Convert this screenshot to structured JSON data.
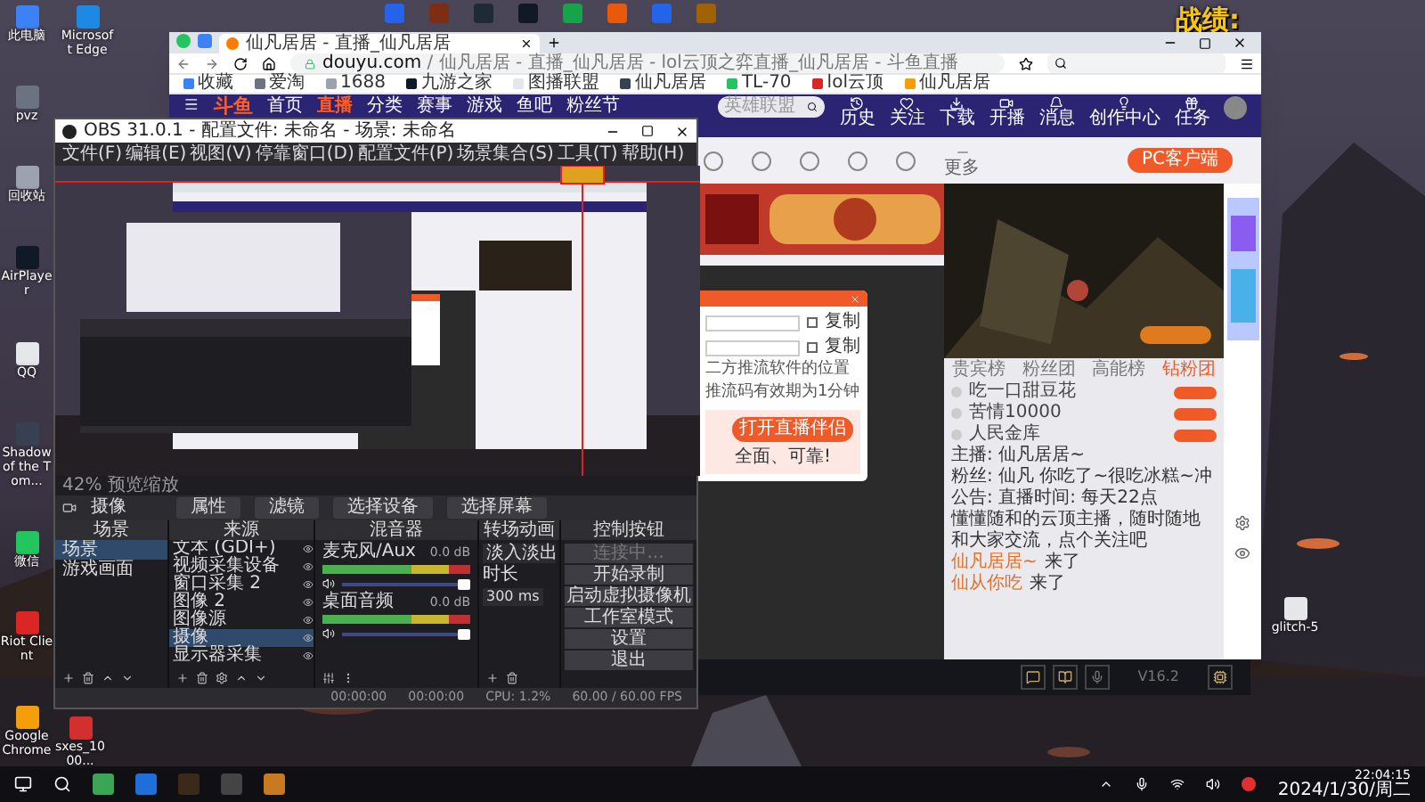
{
  "overlay_text": "战绩:",
  "desktop_icons": [
    {
      "label": "此电脑"
    },
    {
      "label": "pvz"
    },
    {
      "label": "回收站"
    },
    {
      "label": "AirPlayer"
    },
    {
      "label": "QQ"
    },
    {
      "label": "Shadow of the Tom..."
    },
    {
      "label": "微信"
    },
    {
      "label": "Riot Client"
    },
    {
      "label": "Google Chrome"
    }
  ],
  "desktop_icons_2": [
    {
      "label": "Microsoft Edge"
    }
  ],
  "desktop_icon_bottom": {
    "label": "sxes_1000..."
  },
  "desktop_icon_right": {
    "label": "glitch-5"
  },
  "browser": {
    "tab_title": "仙凡居居 - 直播_仙凡居居",
    "url_host": "douyu.com",
    "url_path": " / 仙凡居居 - 直播_仙凡居居 - lol云顶之弈直播_仙凡居居 - 斗鱼直播",
    "bookmarks": [
      "收藏",
      "爱淘",
      "1688",
      "九游之家",
      "图播联盟",
      "仙凡居居",
      "TL-70",
      "lol云顶",
      "仙凡居居"
    ],
    "logo": "斗鱼",
    "nav": [
      {
        "label": "首页",
        "selected": false
      },
      {
        "label": "直播",
        "selected": true
      },
      {
        "label": "分类",
        "selected": false
      },
      {
        "label": "赛事",
        "selected": false
      },
      {
        "label": "游戏",
        "selected": false
      },
      {
        "label": "鱼吧",
        "selected": false
      },
      {
        "label": "粉丝节",
        "selected": false
      }
    ],
    "search_placeholder": "英雄联盟",
    "header_icons": [
      "历史",
      "关注",
      "下载",
      "开播",
      "消息",
      "创作中心",
      "任务"
    ],
    "more_tool": "更多",
    "pc_client_button": "PC客户端",
    "dialog": {
      "copy_labels": [
        {
          "label": "复制",
          "checked": false
        },
        {
          "label": "复制",
          "checked": false
        }
      ],
      "lines": [
        "二方推流软件的位置",
        "推流码有效期为1分钟"
      ],
      "button": "打开直播伴侣",
      "note": "全面、可靠!"
    },
    "chat": {
      "tabs": [
        {
          "label": "贵宾榜",
          "selected": false
        },
        {
          "label": "粉丝团",
          "selected": false
        },
        {
          "label": "高能榜",
          "selected": false
        },
        {
          "label": "钻粉团",
          "selected": true
        }
      ],
      "ranks": [
        "吃一口甜豆花",
        "苦情10000",
        "人民金库"
      ],
      "notices": [
        {
          "label": "主播:",
          "text": "仙凡居居~"
        },
        {
          "label": "粉丝:",
          "text": "仙凡 你吃了~很吃冰糕~冲"
        },
        {
          "label": "公告:",
          "text": "直播时间: 每天22点"
        }
      ],
      "description": "懂懂随和的云顶主播，随时随地和大家交流，点个关注吧",
      "entries": [
        {
          "name": "仙凡居居~",
          "text": "来了"
        },
        {
          "name": "仙从你吃",
          "text": "来了"
        }
      ]
    }
  },
  "lol_bar": {
    "version": "V16.2"
  },
  "obs": {
    "title": "OBS 31.0.1 - 配置文件: 未命名 - 场景: 未命名",
    "menu": [
      "文件(F)",
      "编辑(E)",
      "视图(V)",
      "停靠窗口(D)",
      "配置文件(P)",
      "场景集合(S)",
      "工具(T)",
      "帮助(H)"
    ],
    "preview_scale": "42% 预览缩放",
    "source_label": "摄像",
    "source_buttons": [
      "属性",
      "滤镜",
      "选择设备",
      "选择屏幕"
    ],
    "scenes": {
      "title": "场景",
      "items": [
        {
          "label": "场景",
          "selected": true
        },
        {
          "label": "游戏画面",
          "selected": false
        }
      ]
    },
    "sources": {
      "title": "来源",
      "items": [
        {
          "label": "文本 (GDI+)",
          "selected": false
        },
        {
          "label": "视频采集设备",
          "selected": false
        },
        {
          "label": "窗口采集 2",
          "selected": false
        },
        {
          "label": "图像 2",
          "selected": false
        },
        {
          "label": "图像源",
          "selected": false
        },
        {
          "label": "摄像",
          "selected": true
        },
        {
          "label": "显示器采集",
          "selected": false
        }
      ]
    },
    "mixer": {
      "title": "混音器",
      "channels": [
        {
          "name": "麦克风/Aux",
          "reading": "0.0 dB",
          "level": 1
        },
        {
          "name": "桌面音频",
          "reading": "0.0 dB",
          "level": 1
        }
      ]
    },
    "transitions": {
      "title": "转场动画",
      "type": "淡入淡出",
      "duration_label": "时长",
      "duration": "300 ms"
    },
    "controls": {
      "title": "控制按钮",
      "buttons": [
        {
          "label": "连接中...",
          "disabled": true
        },
        {
          "label": "开始录制",
          "disabled": false
        },
        {
          "label": "启动虚拟摄像机",
          "disabled": false
        },
        {
          "label": "工作室模式",
          "disabled": false
        },
        {
          "label": "设置",
          "disabled": false
        },
        {
          "label": "退出",
          "disabled": false
        }
      ]
    },
    "status": {
      "stream_time": "00:00:00",
      "record_time": "00:00:00",
      "cpu": "CPU: 1.2%",
      "fps": "60.00 / 60.00 FPS"
    }
  },
  "taskbar": {
    "time": "22:04:15",
    "date": "2024/1/30/周二"
  }
}
